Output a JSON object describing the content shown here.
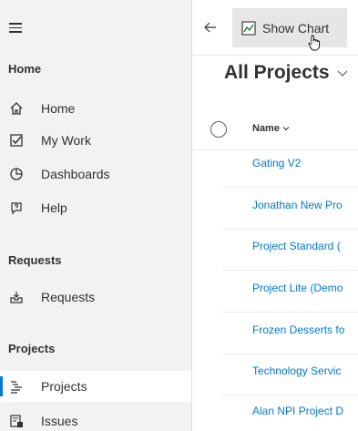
{
  "sidebar": {
    "home_title": "Home",
    "requests_title": "Requests",
    "projects_title": "Projects",
    "items": [
      {
        "label": "Home",
        "icon": "home-icon"
      },
      {
        "label": "My Work",
        "icon": "checkbox-icon"
      },
      {
        "label": "Dashboards",
        "icon": "dashboard-icon"
      },
      {
        "label": "Help",
        "icon": "help-icon"
      },
      {
        "label": "Requests",
        "icon": "inbox-icon"
      },
      {
        "label": "Projects",
        "icon": "projects-icon",
        "active": true
      },
      {
        "label": "Issues",
        "icon": "issues-icon"
      }
    ]
  },
  "toolbar": {
    "show_chart_label": "Show Chart"
  },
  "main": {
    "title": "All Projects",
    "column_name": "Name",
    "rows": [
      "Gating V2",
      "Jonathan New Pro",
      "Project Standard (",
      "Project Lite (Demo",
      "Frozen Desserts fo",
      "Technology Servic",
      "Alan NPI Project D"
    ]
  },
  "colors": {
    "accent": "#0078d4",
    "sidebar_bg": "#f3f2f1",
    "button_bg": "#e6e6e6"
  }
}
